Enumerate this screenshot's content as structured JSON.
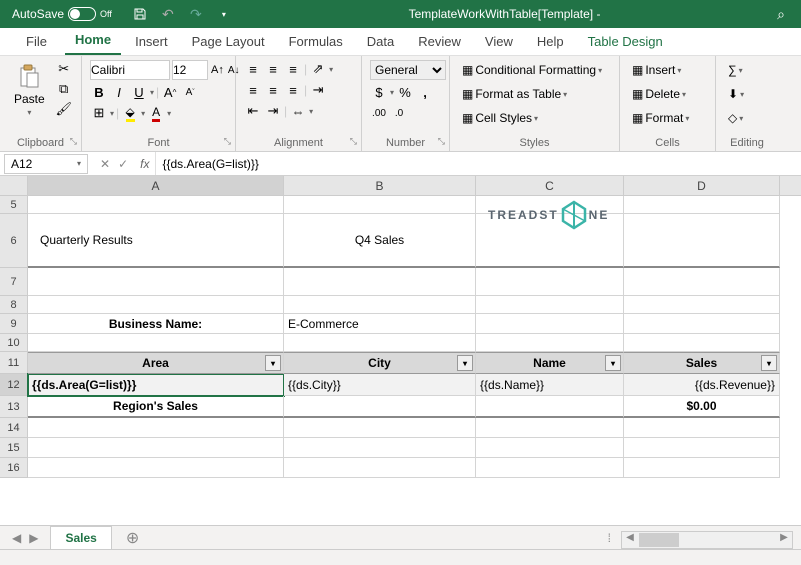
{
  "titlebar": {
    "autosave_label": "AutoSave",
    "autosave_state": "Off",
    "document_title": "TemplateWorkWithTable[Template]  -"
  },
  "tabs": {
    "file": "File",
    "home": "Home",
    "insert": "Insert",
    "page_layout": "Page Layout",
    "formulas": "Formulas",
    "data": "Data",
    "review": "Review",
    "view": "View",
    "help": "Help",
    "table_design": "Table Design"
  },
  "ribbon": {
    "clipboard": {
      "label": "Clipboard",
      "paste": "Paste"
    },
    "font": {
      "label": "Font",
      "name": "Calibri",
      "size": "12"
    },
    "alignment": {
      "label": "Alignment"
    },
    "number": {
      "label": "Number",
      "format": "General"
    },
    "styles": {
      "label": "Styles",
      "cond_fmt": "Conditional Formatting",
      "fmt_table": "Format as Table",
      "cell_styles": "Cell Styles"
    },
    "cells": {
      "label": "Cells",
      "insert": "Insert",
      "delete": "Delete",
      "format": "Format"
    },
    "editing": {
      "label": "Editing"
    }
  },
  "formula_bar": {
    "cell_ref": "A12",
    "formula": "{{ds.Area(G=list)}}"
  },
  "grid": {
    "columns": [
      "A",
      "B",
      "C",
      "D"
    ],
    "rows": [
      "5",
      "6",
      "7",
      "8",
      "9",
      "10",
      "11",
      "12",
      "13",
      "14",
      "15",
      "16"
    ],
    "title": "Quarterly Results",
    "subtitle": "Q4 Sales",
    "business_name_label": "Business Name:",
    "business_name_value": "E-Commerce",
    "headers": {
      "area": "Area",
      "city": "City",
      "name": "Name",
      "sales": "Sales"
    },
    "row12": {
      "area": "{{ds.Area(G=list)}}",
      "city": "{{ds.City}}",
      "name": "{{ds.Name}}",
      "sales": "{{ds.Revenue}}"
    },
    "footer": {
      "label": "Region's Sales",
      "total": "$0.00"
    },
    "logo_text": "TREADST",
    "logo_text2": "NE"
  },
  "sheets": {
    "active": "Sales"
  }
}
